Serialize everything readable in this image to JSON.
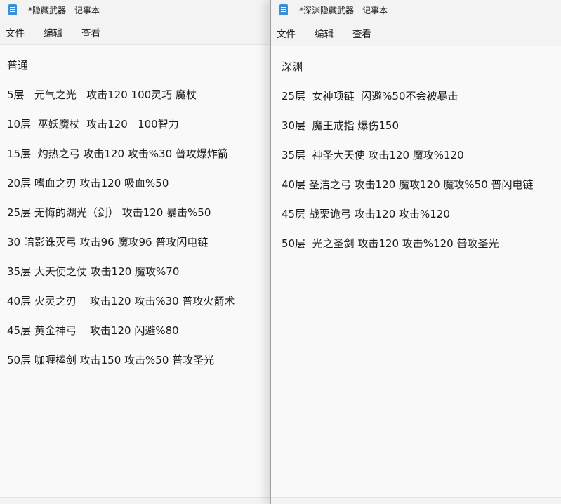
{
  "left_window": {
    "title": "*隐藏武器 - 记事本",
    "menu": [
      "文件",
      "编辑",
      "查看"
    ],
    "lines": [
      "普通",
      "5层   元气之光   攻击120 100灵巧 魔杖",
      "10层  巫妖魔杖  攻击120   100智力",
      "15层  灼热之弓 攻击120 攻击%30 普攻爆炸箭",
      "20层 嗜血之刃 攻击120 吸血%50",
      "25层 无悔的湖光（剑） 攻击120 暴击%50",
      "30 暗影诛灭弓 攻击96 魔攻96 普攻闪电链",
      "35层 大天使之仗 攻击120 魔攻%70",
      "40层 火灵之刃    攻击120 攻击%30 普攻火箭术",
      "45层 黄金神弓    攻击120 闪避%80",
      "50层 咖喱棒剑 攻击150 攻击%50 普攻圣光"
    ]
  },
  "right_window": {
    "title": "*深渊隐藏武器 - 记事本",
    "menu": [
      "文件",
      "编辑",
      "查看"
    ],
    "lines": [
      "深渊",
      "25层  女神项链  闪避%50不会被暴击",
      "30层  魔王戒指 爆伤150",
      "35层  神圣大天使 攻击120 魔攻%120",
      "40层 圣洁之弓 攻击120 魔攻120 魔攻%50 普闪电链",
      "45层 战栗诡弓 攻击120 攻击%120",
      "50层  光之圣剑 攻击120 攻击%120 普攻圣光"
    ]
  }
}
